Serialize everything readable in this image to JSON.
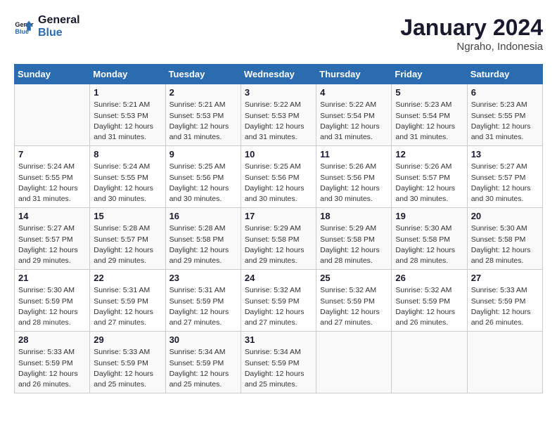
{
  "header": {
    "logo_line1": "General",
    "logo_line2": "Blue",
    "month": "January 2024",
    "location": "Ngraho, Indonesia"
  },
  "days_of_week": [
    "Sunday",
    "Monday",
    "Tuesday",
    "Wednesday",
    "Thursday",
    "Friday",
    "Saturday"
  ],
  "weeks": [
    [
      {
        "day": "",
        "info": ""
      },
      {
        "day": "1",
        "info": "Sunrise: 5:21 AM\nSunset: 5:53 PM\nDaylight: 12 hours\nand 31 minutes."
      },
      {
        "day": "2",
        "info": "Sunrise: 5:21 AM\nSunset: 5:53 PM\nDaylight: 12 hours\nand 31 minutes."
      },
      {
        "day": "3",
        "info": "Sunrise: 5:22 AM\nSunset: 5:53 PM\nDaylight: 12 hours\nand 31 minutes."
      },
      {
        "day": "4",
        "info": "Sunrise: 5:22 AM\nSunset: 5:54 PM\nDaylight: 12 hours\nand 31 minutes."
      },
      {
        "day": "5",
        "info": "Sunrise: 5:23 AM\nSunset: 5:54 PM\nDaylight: 12 hours\nand 31 minutes."
      },
      {
        "day": "6",
        "info": "Sunrise: 5:23 AM\nSunset: 5:55 PM\nDaylight: 12 hours\nand 31 minutes."
      }
    ],
    [
      {
        "day": "7",
        "info": "Sunrise: 5:24 AM\nSunset: 5:55 PM\nDaylight: 12 hours\nand 31 minutes."
      },
      {
        "day": "8",
        "info": "Sunrise: 5:24 AM\nSunset: 5:55 PM\nDaylight: 12 hours\nand 30 minutes."
      },
      {
        "day": "9",
        "info": "Sunrise: 5:25 AM\nSunset: 5:56 PM\nDaylight: 12 hours\nand 30 minutes."
      },
      {
        "day": "10",
        "info": "Sunrise: 5:25 AM\nSunset: 5:56 PM\nDaylight: 12 hours\nand 30 minutes."
      },
      {
        "day": "11",
        "info": "Sunrise: 5:26 AM\nSunset: 5:56 PM\nDaylight: 12 hours\nand 30 minutes."
      },
      {
        "day": "12",
        "info": "Sunrise: 5:26 AM\nSunset: 5:57 PM\nDaylight: 12 hours\nand 30 minutes."
      },
      {
        "day": "13",
        "info": "Sunrise: 5:27 AM\nSunset: 5:57 PM\nDaylight: 12 hours\nand 30 minutes."
      }
    ],
    [
      {
        "day": "14",
        "info": "Sunrise: 5:27 AM\nSunset: 5:57 PM\nDaylight: 12 hours\nand 29 minutes."
      },
      {
        "day": "15",
        "info": "Sunrise: 5:28 AM\nSunset: 5:57 PM\nDaylight: 12 hours\nand 29 minutes."
      },
      {
        "day": "16",
        "info": "Sunrise: 5:28 AM\nSunset: 5:58 PM\nDaylight: 12 hours\nand 29 minutes."
      },
      {
        "day": "17",
        "info": "Sunrise: 5:29 AM\nSunset: 5:58 PM\nDaylight: 12 hours\nand 29 minutes."
      },
      {
        "day": "18",
        "info": "Sunrise: 5:29 AM\nSunset: 5:58 PM\nDaylight: 12 hours\nand 28 minutes."
      },
      {
        "day": "19",
        "info": "Sunrise: 5:30 AM\nSunset: 5:58 PM\nDaylight: 12 hours\nand 28 minutes."
      },
      {
        "day": "20",
        "info": "Sunrise: 5:30 AM\nSunset: 5:58 PM\nDaylight: 12 hours\nand 28 minutes."
      }
    ],
    [
      {
        "day": "21",
        "info": "Sunrise: 5:30 AM\nSunset: 5:59 PM\nDaylight: 12 hours\nand 28 minutes."
      },
      {
        "day": "22",
        "info": "Sunrise: 5:31 AM\nSunset: 5:59 PM\nDaylight: 12 hours\nand 27 minutes."
      },
      {
        "day": "23",
        "info": "Sunrise: 5:31 AM\nSunset: 5:59 PM\nDaylight: 12 hours\nand 27 minutes."
      },
      {
        "day": "24",
        "info": "Sunrise: 5:32 AM\nSunset: 5:59 PM\nDaylight: 12 hours\nand 27 minutes."
      },
      {
        "day": "25",
        "info": "Sunrise: 5:32 AM\nSunset: 5:59 PM\nDaylight: 12 hours\nand 27 minutes."
      },
      {
        "day": "26",
        "info": "Sunrise: 5:32 AM\nSunset: 5:59 PM\nDaylight: 12 hours\nand 26 minutes."
      },
      {
        "day": "27",
        "info": "Sunrise: 5:33 AM\nSunset: 5:59 PM\nDaylight: 12 hours\nand 26 minutes."
      }
    ],
    [
      {
        "day": "28",
        "info": "Sunrise: 5:33 AM\nSunset: 5:59 PM\nDaylight: 12 hours\nand 26 minutes."
      },
      {
        "day": "29",
        "info": "Sunrise: 5:33 AM\nSunset: 5:59 PM\nDaylight: 12 hours\nand 25 minutes."
      },
      {
        "day": "30",
        "info": "Sunrise: 5:34 AM\nSunset: 5:59 PM\nDaylight: 12 hours\nand 25 minutes."
      },
      {
        "day": "31",
        "info": "Sunrise: 5:34 AM\nSunset: 5:59 PM\nDaylight: 12 hours\nand 25 minutes."
      },
      {
        "day": "",
        "info": ""
      },
      {
        "day": "",
        "info": ""
      },
      {
        "day": "",
        "info": ""
      }
    ]
  ]
}
